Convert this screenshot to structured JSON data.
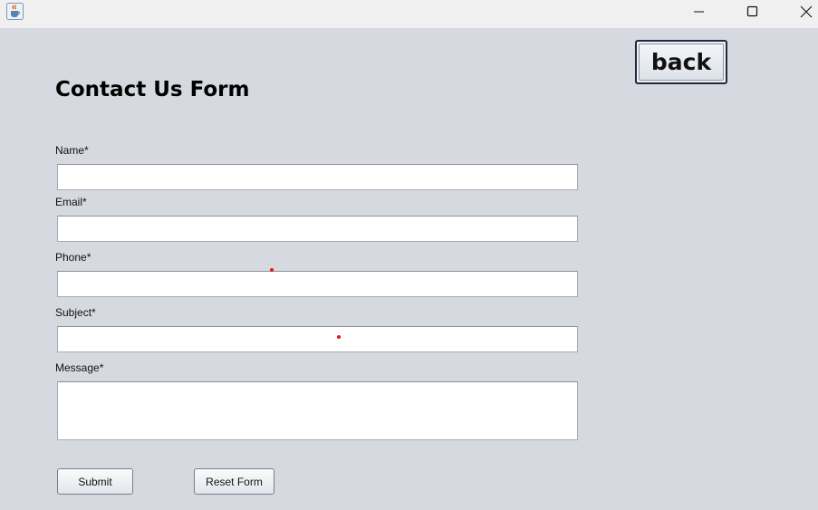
{
  "window": {
    "app_icon": "java-cup-icon",
    "controls": [
      "minimize-icon",
      "maximize-icon",
      "close-icon"
    ]
  },
  "back_button": {
    "label": "back"
  },
  "form": {
    "title": "Contact Us Form",
    "fields": [
      {
        "label": "Name*",
        "value": ""
      },
      {
        "label": "Email*",
        "value": ""
      },
      {
        "label": "Phone*",
        "value": ""
      },
      {
        "label": "Subject*",
        "value": ""
      },
      {
        "label": "Message*",
        "value": ""
      }
    ],
    "submit_label": "Submit",
    "reset_label": "Reset Form"
  },
  "colors": {
    "background": "#d6d9e0",
    "titlebar": "#f0f0f0",
    "marker": "#e0131a"
  }
}
